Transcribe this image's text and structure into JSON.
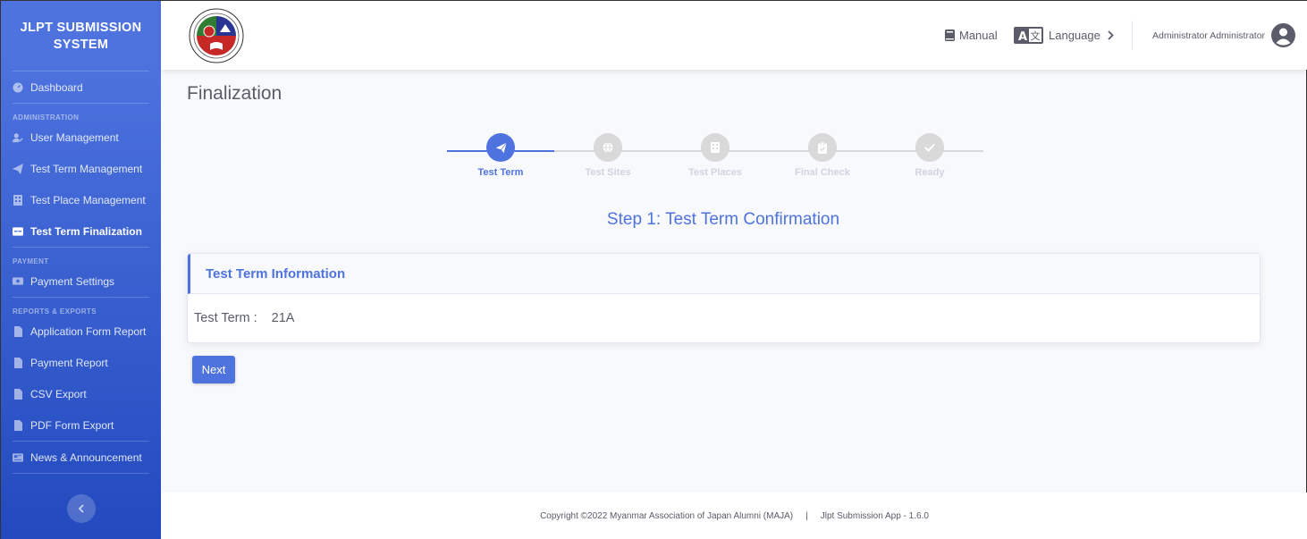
{
  "sidebar": {
    "brand_line1": "JLPT SUBMISSION",
    "brand_line2": "SYSTEM",
    "dashboard": "Dashboard",
    "heading_admin": "ADMINISTRATION",
    "user_management": "User Management",
    "test_term_management": "Test Term Management",
    "test_place_management": "Test Place Management",
    "test_term_finalization": "Test Term Finalization",
    "heading_payment": "PAYMENT",
    "payment_settings": "Payment Settings",
    "heading_reports": "REPORTS & EXPORTS",
    "application_form_report": "Application Form Report",
    "payment_report": "Payment Report",
    "csv_export": "CSV Export",
    "pdf_form_export": "PDF Form Export",
    "news_announcement": "News & Announcement"
  },
  "topbar": {
    "manual": "Manual",
    "language": "Language",
    "user_name": "Administrator Administrator"
  },
  "page": {
    "title": "Finalization",
    "step_heading": "Step 1: Test Term Confirmation"
  },
  "steps": [
    {
      "label": "Test Term",
      "icon": "paper-plane-icon",
      "active": true
    },
    {
      "label": "Test Sites",
      "icon": "globe-icon",
      "active": false
    },
    {
      "label": "Test Places",
      "icon": "building-icon",
      "active": false
    },
    {
      "label": "Final Check",
      "icon": "clipboard-check-icon",
      "active": false
    },
    {
      "label": "Ready",
      "icon": "check-icon",
      "active": false
    }
  ],
  "card": {
    "header": "Test Term Information",
    "field_label": "Test Term :",
    "field_value": "21A"
  },
  "buttons": {
    "next": "Next"
  },
  "footer": {
    "copyright": "Copyright ©2022 Myanmar Association of Japan Alumni (MAJA)",
    "separator": "|",
    "version": "Jlpt Submission App - 1.6.0"
  },
  "colors": {
    "primary": "#4e73df",
    "sidebar_end": "#224abe",
    "inactive_step": "#d9d9d9",
    "text": "#5a5c69"
  }
}
